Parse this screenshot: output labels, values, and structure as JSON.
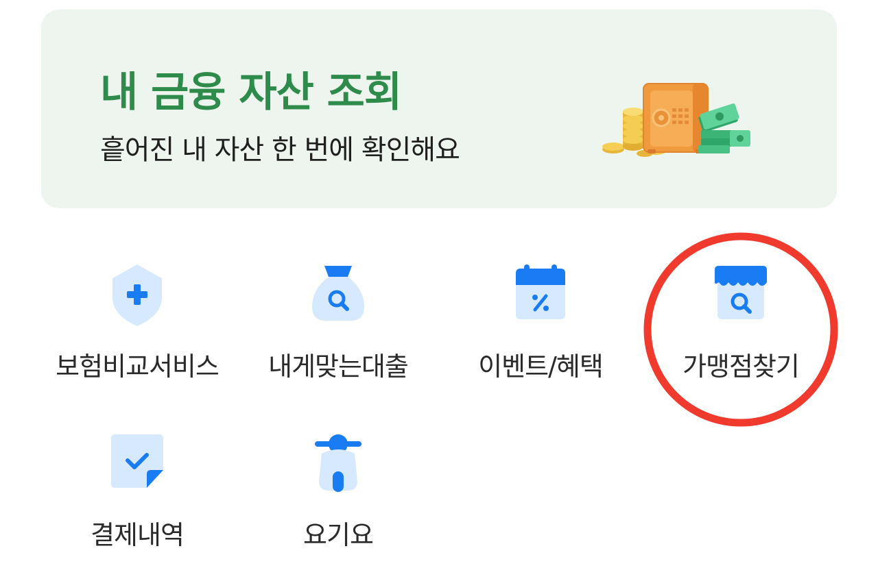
{
  "banner": {
    "title": "내 금융 자산 조회",
    "subtitle": "흩어진 내 자산 한 번에 확인해요",
    "illustration": "safe-with-coins-and-cash-illustration"
  },
  "menu": {
    "items": [
      {
        "label": "보험비교서비스",
        "icon": "shield-plus-icon"
      },
      {
        "label": "내게맞는대출",
        "icon": "money-bag-search-icon"
      },
      {
        "label": "이벤트/혜택",
        "icon": "calendar-percent-icon"
      },
      {
        "label": "가맹점찾기",
        "icon": "store-search-icon",
        "highlighted": true
      },
      {
        "label": "결제내역",
        "icon": "document-check-icon"
      },
      {
        "label": "요기요",
        "icon": "scooter-icon"
      }
    ]
  },
  "colors": {
    "banner_background": "#eef5ef",
    "banner_title": "#2e8b4b",
    "icon_light": "#d6e9ff",
    "icon_primary": "#1a7cf2",
    "highlight_ring": "#f03a2e"
  }
}
